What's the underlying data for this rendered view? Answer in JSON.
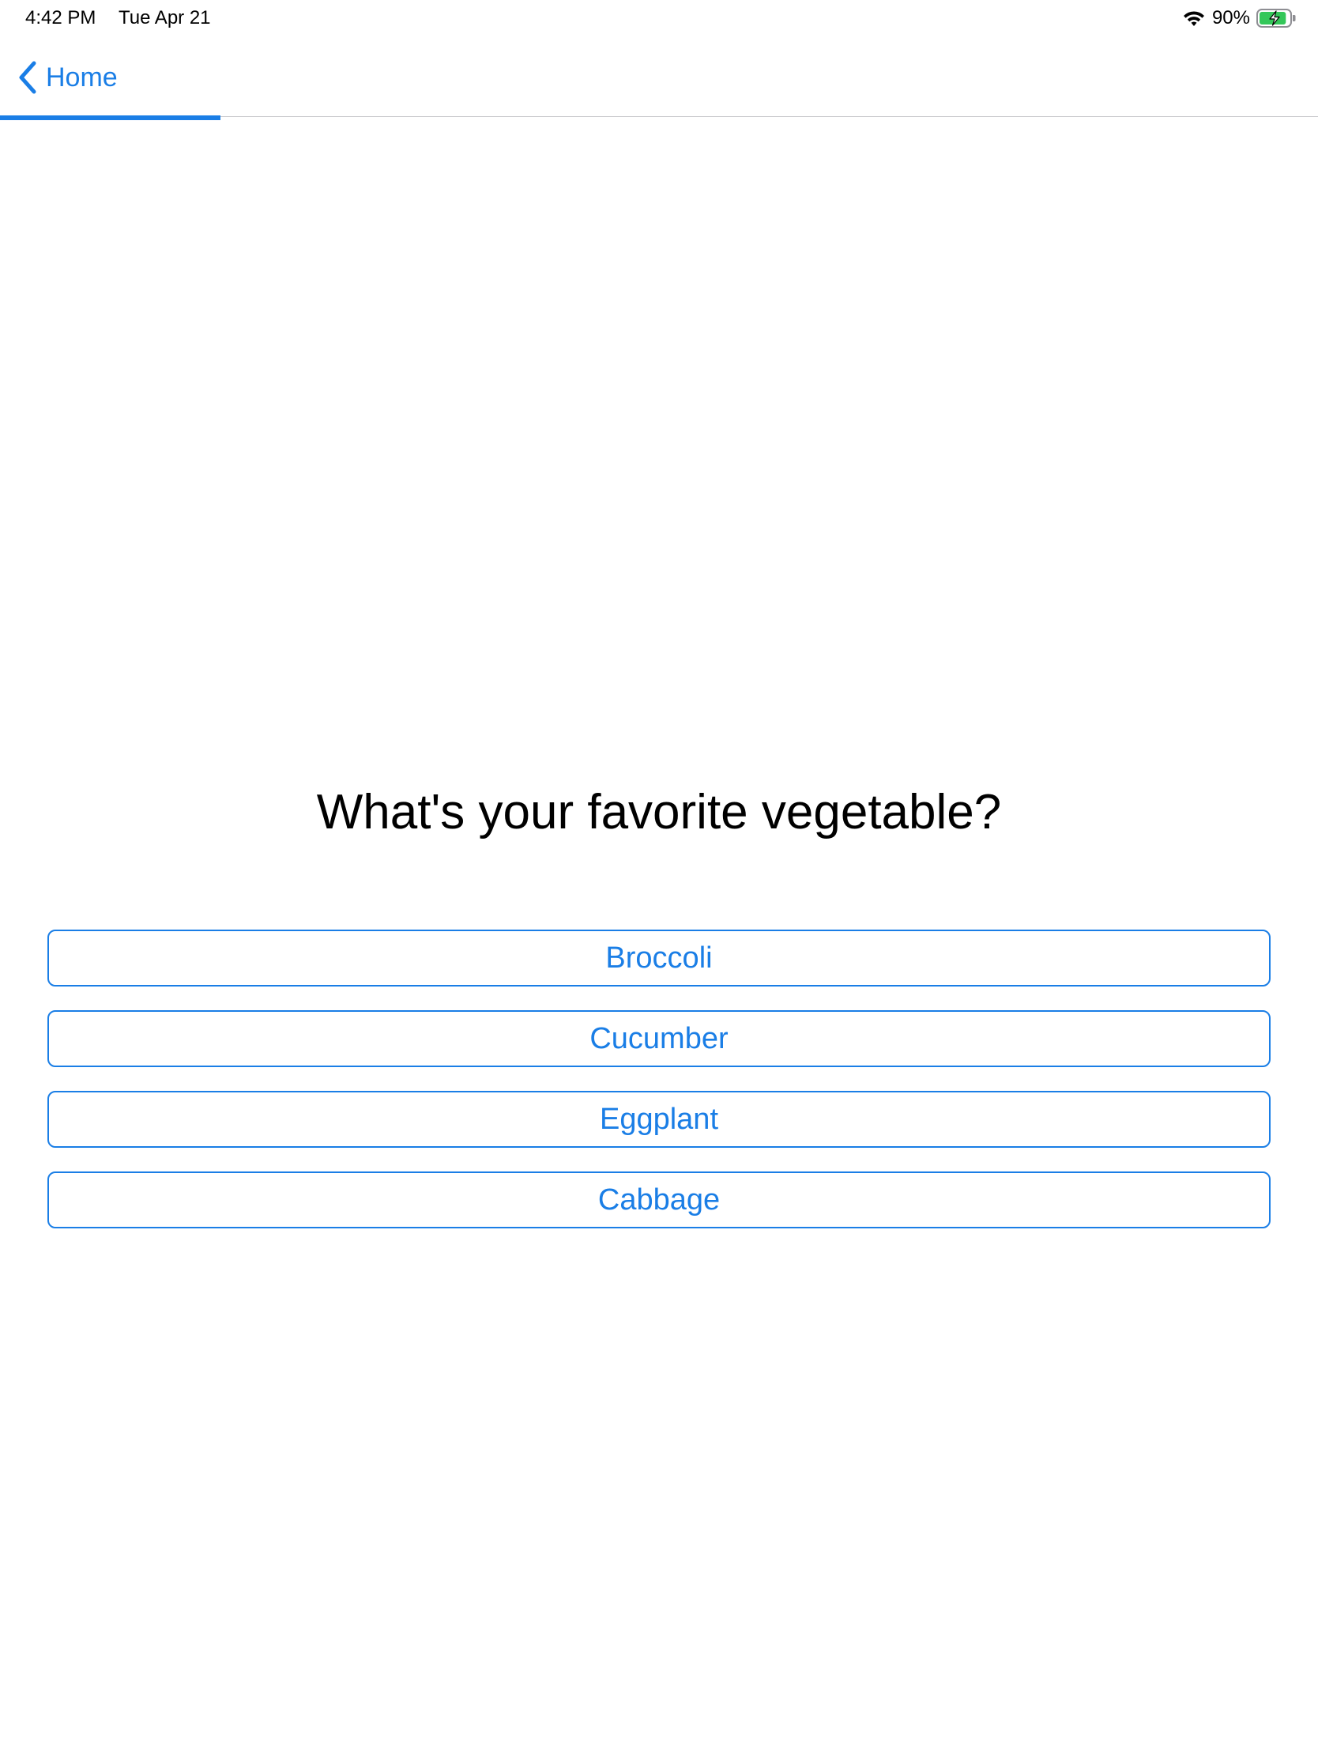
{
  "colors": {
    "accent": "#1a7ee6",
    "battery_green": "#34c759"
  },
  "status_bar": {
    "time": "4:42 PM",
    "date": "Tue Apr 21",
    "wifi_icon": "wifi-icon",
    "battery_percent": "90%",
    "battery_icon": "battery-charging-icon",
    "battery_level": 0.9
  },
  "nav": {
    "back_icon": "chevron-left-icon",
    "back_label": "Home",
    "progress_fraction": 0.167
  },
  "survey": {
    "question": "What's your favorite vegetable?",
    "options": [
      "Broccoli",
      "Cucumber",
      "Eggplant",
      "Cabbage"
    ]
  }
}
